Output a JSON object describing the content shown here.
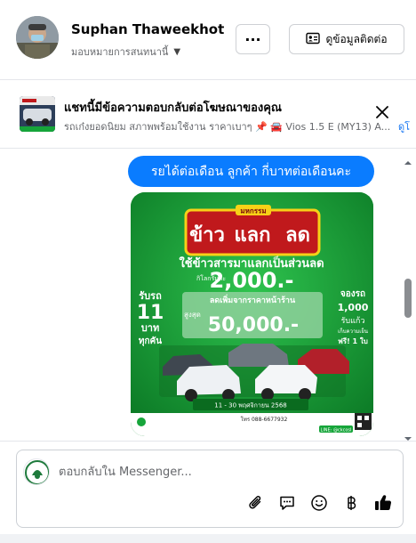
{
  "header": {
    "name": "Suphan Thaweekhot",
    "subtitle": "มอบหมายการสนทนานี้",
    "more_label": "···",
    "contact_label": "ดูข้อมูลติดต่อ"
  },
  "ad": {
    "title": "แชทนี้มีข้อความตอบกลับต่อโฆษณาของคุณ",
    "description": "รถเก๋งยอดนิยม สภาพพร้อมใช้งาน ราคาเบาๆ 📌 🚘 Vios 1.5 E (MY13) A...",
    "link": "ดูโ"
  },
  "messages": {
    "bubble_text": "รยได้ต่อเดือน  ลูกค้า  กี่บาทต่อเดือนคะ",
    "poster": {
      "badge": "มหกรรม",
      "headline_1": "ข้าว",
      "headline_2": "แลก",
      "headline_3": "ลด",
      "sub_1": "ใช้ข้าวสารมาแลกเป็นส่วนลด",
      "per_kg": "กิโลกรัมละ",
      "per_kg_value": "2,000.-",
      "discount_label": "ลดเพิ่มจากราคาหน้าร้าน",
      "max_label": "สูงสุด",
      "max_value": "50,000.-",
      "left_1": "รับรถ",
      "left_2": "11",
      "left_3": "บาท",
      "left_4": "ทุกคัน",
      "right_1": "จองรถ",
      "right_2": "1,000",
      "right_3": "รับแก้ว",
      "right_4": "เก็บความเย็น",
      "right_5": "ฟรี! 1 ใบ",
      "date": "11 - 30 พฤศจิกายน 2568",
      "phone": "โทร 088-6677932",
      "line": "LINE: @ckcosl"
    }
  },
  "composer": {
    "placeholder": "ตอบกลับใน Messenger..."
  },
  "colors": {
    "bubble": "#0a7cff",
    "poster_green": "#169a34",
    "poster_red": "#c0191c",
    "poster_yellow": "#f7d117",
    "link": "#1877f2"
  },
  "icons": {
    "contact": "contact-card-icon",
    "close": "close-icon",
    "attach": "paperclip-icon",
    "saved_reply": "speech-bubble-icon",
    "emoji": "smiley-icon",
    "payment": "baht-icon",
    "like": "thumbs-up-icon"
  }
}
